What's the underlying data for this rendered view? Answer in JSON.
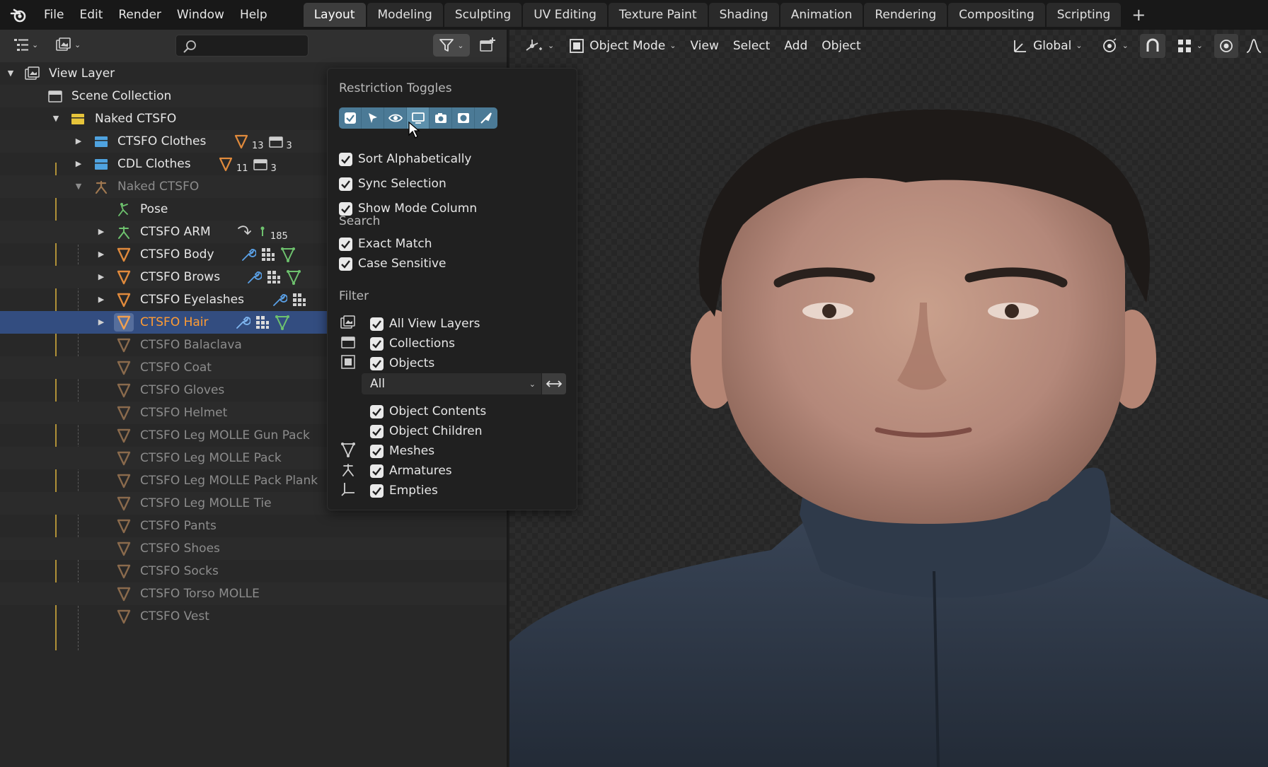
{
  "menu": [
    "File",
    "Edit",
    "Render",
    "Window",
    "Help"
  ],
  "workspaces": [
    "Layout",
    "Modeling",
    "Sculpting",
    "UV Editing",
    "Texture Paint",
    "Shading",
    "Animation",
    "Rendering",
    "Compositing",
    "Scripting"
  ],
  "active_workspace": "Layout",
  "outliner": {
    "search_placeholder": "",
    "rows": [
      {
        "label": "View Layer"
      },
      {
        "label": "Scene Collection"
      },
      {
        "label": "Naked CTSFO"
      },
      {
        "label": "CTSFO Clothes",
        "count1": "13",
        "count2": "3"
      },
      {
        "label": "CDL Clothes",
        "count1": "11",
        "count2": "3"
      },
      {
        "label": "Naked CTSFO"
      },
      {
        "label": "Pose"
      },
      {
        "label": "CTSFO ARM",
        "count1": "185"
      },
      {
        "label": "CTSFO Body"
      },
      {
        "label": "CTSFO Brows"
      },
      {
        "label": "CTSFO Eyelashes"
      },
      {
        "label": "CTSFO Hair"
      },
      {
        "label": "CTSFO Balaclava"
      },
      {
        "label": "CTSFO Coat"
      },
      {
        "label": "CTSFO Gloves"
      },
      {
        "label": "CTSFO Helmet"
      },
      {
        "label": "CTSFO Leg MOLLE Gun Pack"
      },
      {
        "label": "CTSFO Leg MOLLE Pack"
      },
      {
        "label": "CTSFO Leg MOLLE Pack Plank"
      },
      {
        "label": "CTSFO Leg MOLLE Tie"
      },
      {
        "label": "CTSFO Pants"
      },
      {
        "label": "CTSFO Shoes"
      },
      {
        "label": "CTSFO Socks"
      },
      {
        "label": "CTSFO Torso MOLLE"
      },
      {
        "label": "CTSFO Vest"
      }
    ]
  },
  "viewport_header": {
    "mode": "Object Mode",
    "menus": [
      "View",
      "Select",
      "Add",
      "Object"
    ],
    "orientation": "Global"
  },
  "filter_popover": {
    "restriction_title": "Restriction Toggles",
    "sort_alphabetically": "Sort Alphabetically",
    "sync_selection": "Sync Selection",
    "show_mode_column": "Show Mode Column",
    "search_title": "Search",
    "exact_match": "Exact Match",
    "case_sensitive": "Case Sensitive",
    "filter_title": "Filter",
    "all_view_layers": "All View Layers",
    "collections": "Collections",
    "objects": "Objects",
    "object_type": "All",
    "object_contents": "Object Contents",
    "object_children": "Object Children",
    "meshes": "Meshes",
    "armatures": "Armatures",
    "empties": "Empties"
  },
  "colors": {
    "accent": "#4b7a96",
    "selected_row": "#334d80",
    "active_object_text": "#ff9c33",
    "collection_icon": "#4fa3e0",
    "mesh_icon": "#e08a3c",
    "armature_icon": "#6ec26e"
  }
}
